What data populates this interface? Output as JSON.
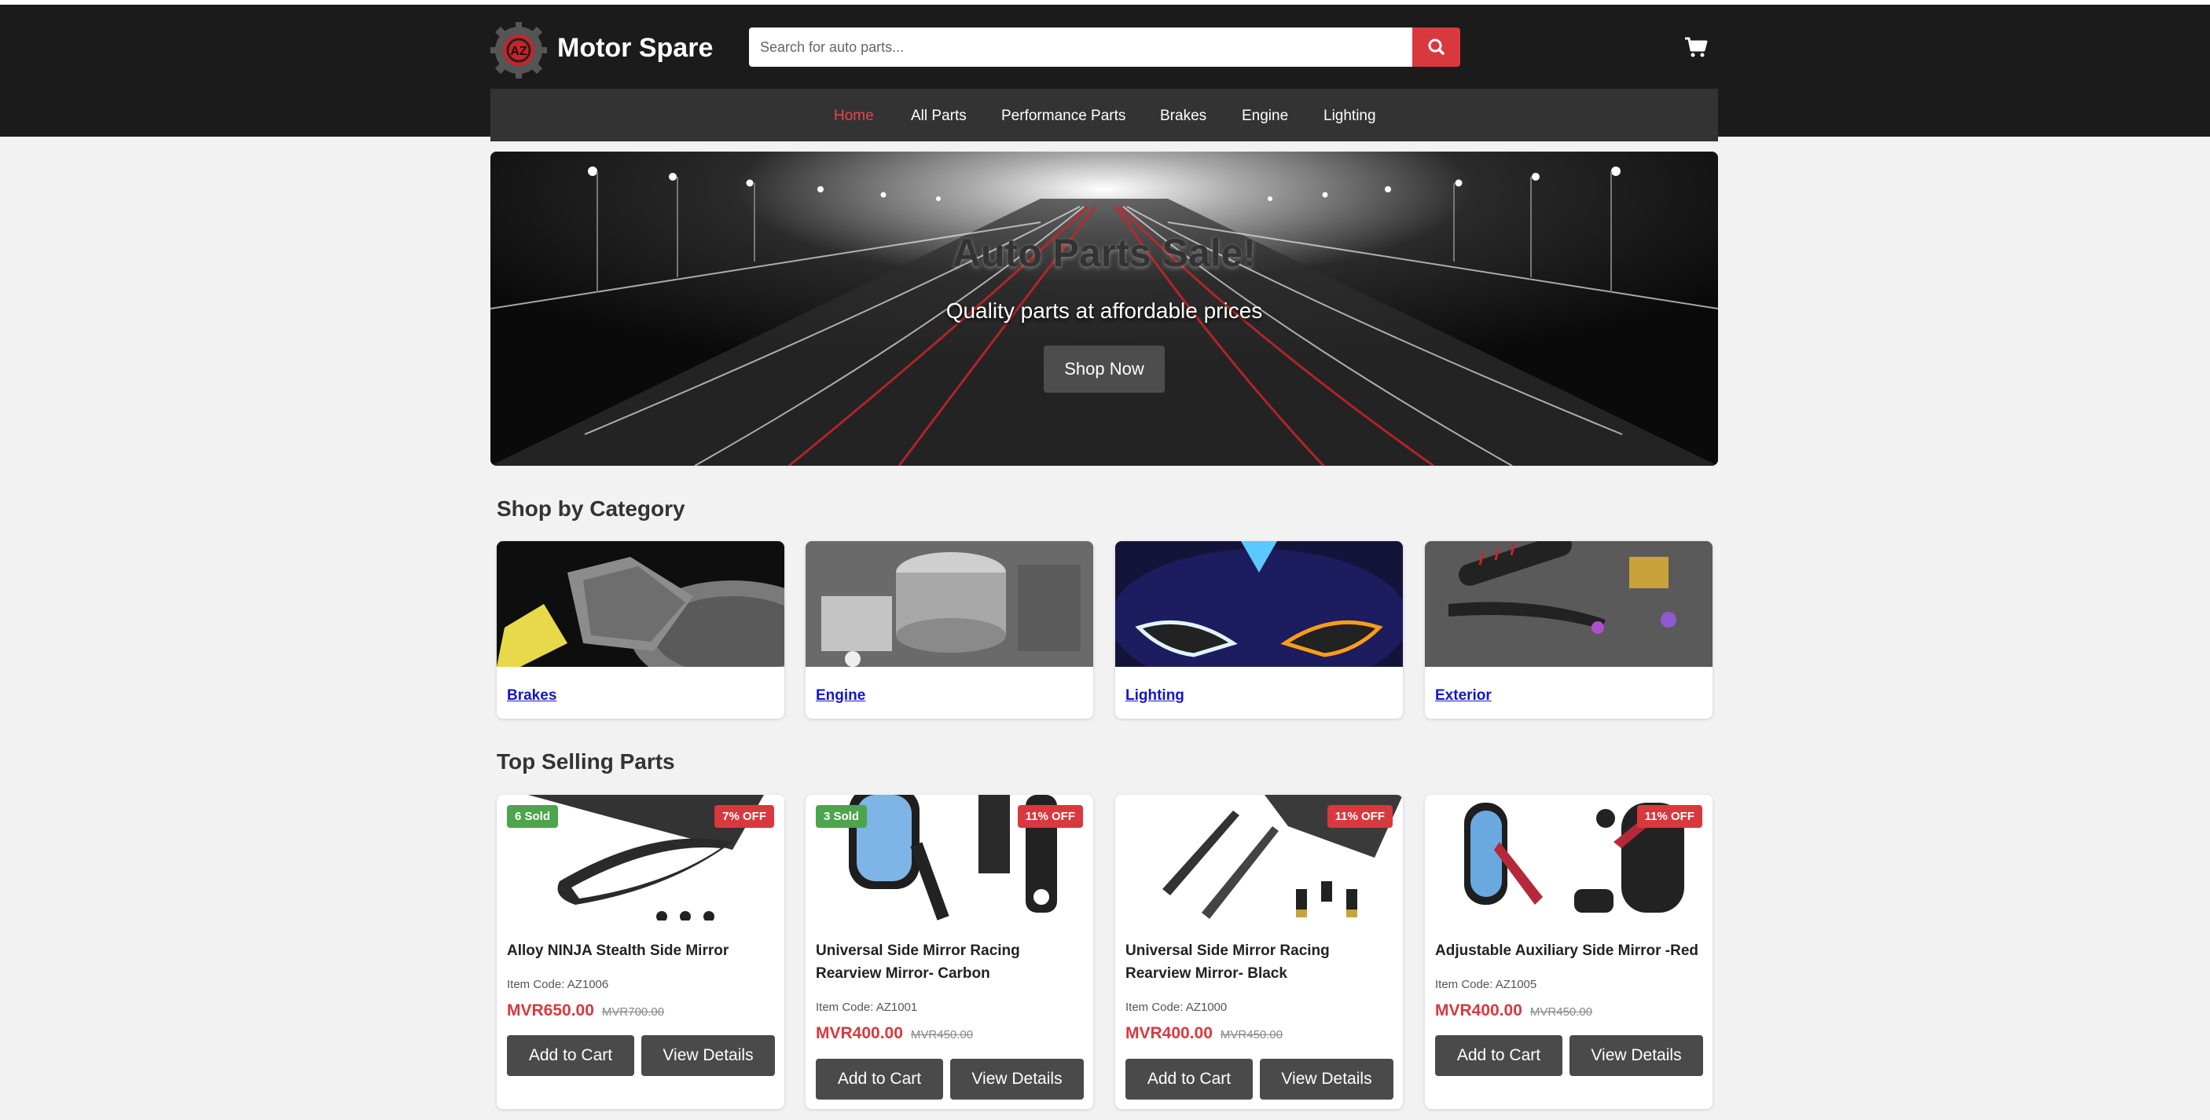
{
  "header": {
    "brand": "Motor Spare",
    "logo_text": "AZ",
    "search_placeholder": "Search for auto parts...",
    "search_icon": "search-icon",
    "cart_icon": "cart-icon"
  },
  "nav": {
    "items": [
      {
        "label": "Home",
        "active": true
      },
      {
        "label": "All Parts",
        "active": false
      },
      {
        "label": "Performance Parts",
        "active": false
      },
      {
        "label": "Brakes",
        "active": false
      },
      {
        "label": "Engine",
        "active": false
      },
      {
        "label": "Lighting",
        "active": false
      }
    ]
  },
  "hero": {
    "title": "Auto Parts Sale!",
    "subtitle": "Quality parts at affordable prices",
    "button": "Shop Now"
  },
  "categories": {
    "title": "Shop by Category",
    "items": [
      {
        "label": "Brakes"
      },
      {
        "label": "Engine"
      },
      {
        "label": "Lighting"
      },
      {
        "label": "Exterior"
      }
    ]
  },
  "products": {
    "title": "Top Selling Parts",
    "items": [
      {
        "sold": "6 Sold",
        "discount": "7% OFF",
        "name": "Alloy NINJA Stealth Side Mirror",
        "code": "Item Code: AZ1006",
        "price": "MVR650.00",
        "old_price": "MVR700.00",
        "add_label": "Add to Cart",
        "details_label": "View Details"
      },
      {
        "sold": "3 Sold",
        "discount": "11% OFF",
        "name": "Universal Side Mirror Racing Rearview Mirror- Carbon",
        "code": "Item Code: AZ1001",
        "price": "MVR400.00",
        "old_price": "MVR450.00",
        "add_label": "Add to Cart",
        "details_label": "View Details"
      },
      {
        "sold": "",
        "discount": "11% OFF",
        "name": "Universal Side Mirror Racing Rearview Mirror- Black",
        "code": "Item Code: AZ1000",
        "price": "MVR400.00",
        "old_price": "MVR450.00",
        "add_label": "Add to Cart",
        "details_label": "View Details"
      },
      {
        "sold": "",
        "discount": "11% OFF",
        "name": "Adjustable Auxiliary Side Mirror -Red",
        "code": "Item Code: AZ1005",
        "price": "MVR400.00",
        "old_price": "MVR450.00",
        "add_label": "Add to Cart",
        "details_label": "View Details"
      }
    ]
  },
  "colors": {
    "header_bg": "#1b1b1b",
    "nav_bg": "#333333",
    "accent": "#d9383f",
    "sold_badge": "#4ca54c",
    "link": "#1515c8"
  }
}
